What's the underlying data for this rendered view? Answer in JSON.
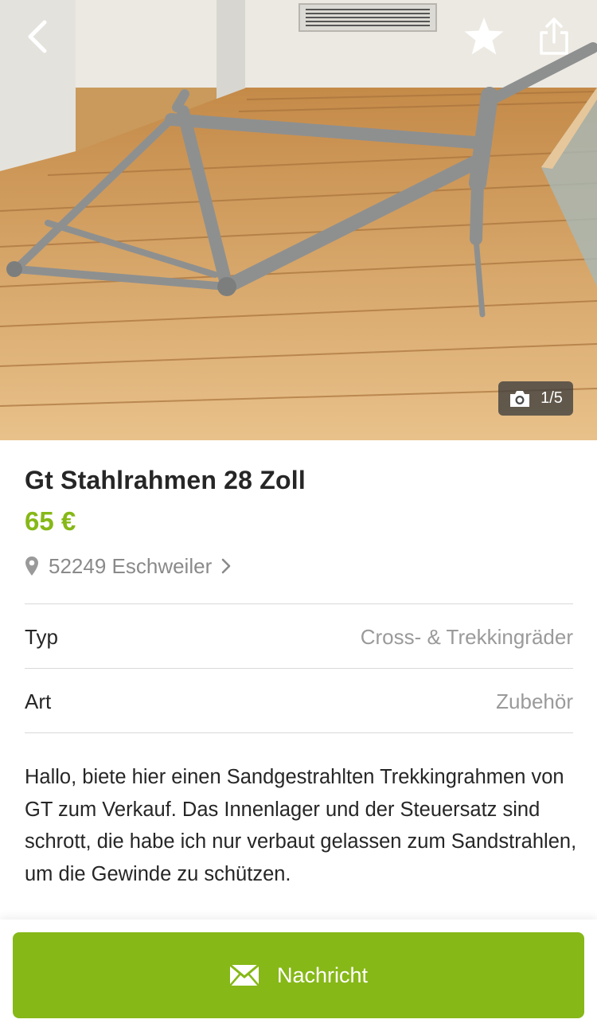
{
  "photo": {
    "counter": "1/5",
    "icons": {
      "back": "chevron-left-icon",
      "favorite": "star-icon",
      "share": "share-icon",
      "camera": "camera-icon"
    }
  },
  "listing": {
    "title": "Gt Stahlrahmen 28 Zoll",
    "price": "65 €",
    "location": "52249 Eschweiler",
    "attributes": [
      {
        "label": "Typ",
        "value": "Cross- & Trekkingräder"
      },
      {
        "label": "Art",
        "value": "Zubehör"
      }
    ],
    "description": "Hallo, biete hier einen Sandgestrahlten Trekkingrahmen von GT zum Verkauf. Das Innenlager und der Steuersatz sind schrott, die habe ich nur verbaut gelassen zum Sandstrahlen, um die Gewinde zu schützen."
  },
  "actions": {
    "message_label": "Nachricht"
  },
  "colors": {
    "accent_green": "#86b817",
    "text_dark": "#262626",
    "text_muted": "#9a9a9a"
  }
}
